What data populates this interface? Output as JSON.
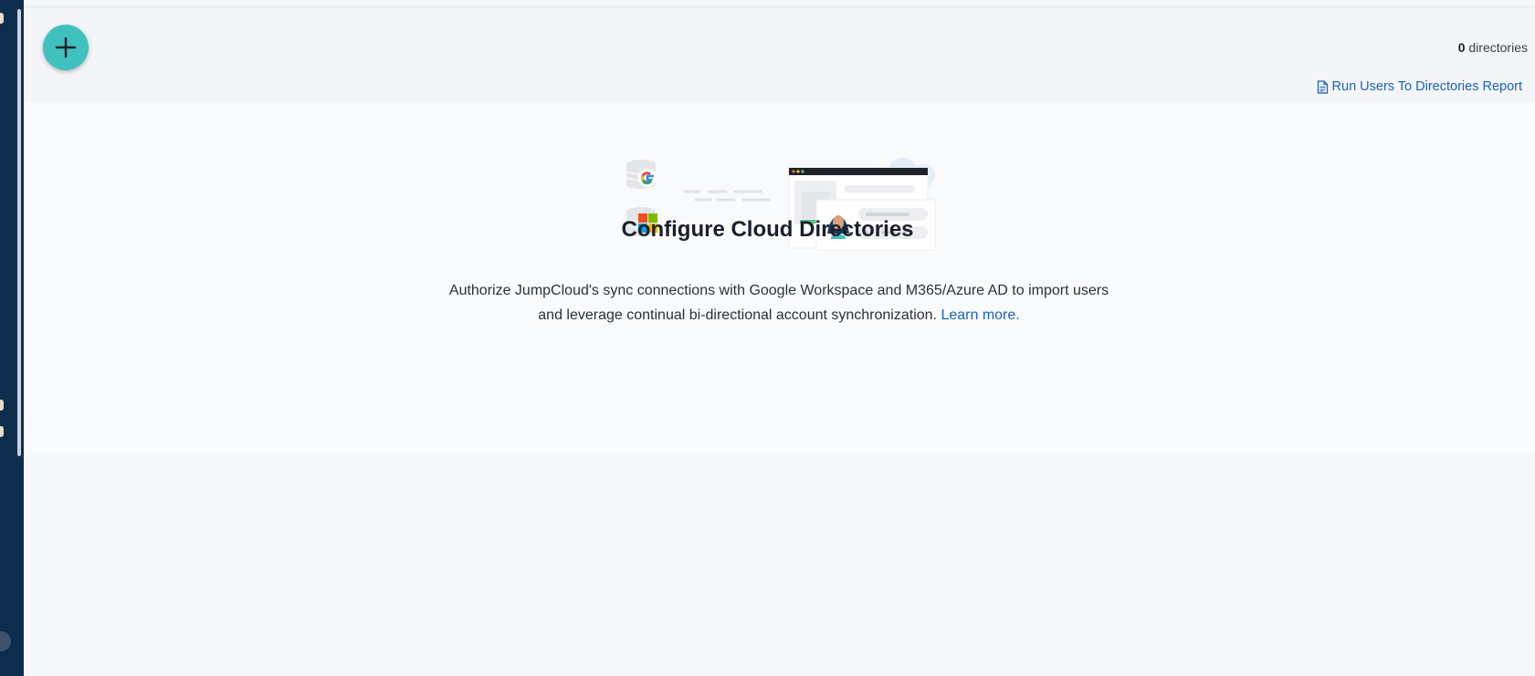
{
  "toolbar": {
    "add_button_icon": "plus-icon",
    "count_value": "0",
    "count_label": "directories",
    "report_link_label": "Run Users To Directories Report",
    "report_icon": "document-icon"
  },
  "empty_state": {
    "title": "Configure Cloud Directories",
    "description": "Authorize JumpCloud's sync connections with Google Workspace and M365/Azure AD to import users and leverage continual bi-directional account synchronization.",
    "learn_more_label": "Learn more.",
    "illustration_icons": [
      "google-database-icon",
      "microsoft-database-icon",
      "browser-window-icon",
      "user-avatar-icon",
      "cloud-icon"
    ]
  },
  "colors": {
    "sidebar": "#0e2d4d",
    "accent": "#3fc1be",
    "link": "#1a62b8",
    "background": "#f6f7fb"
  }
}
